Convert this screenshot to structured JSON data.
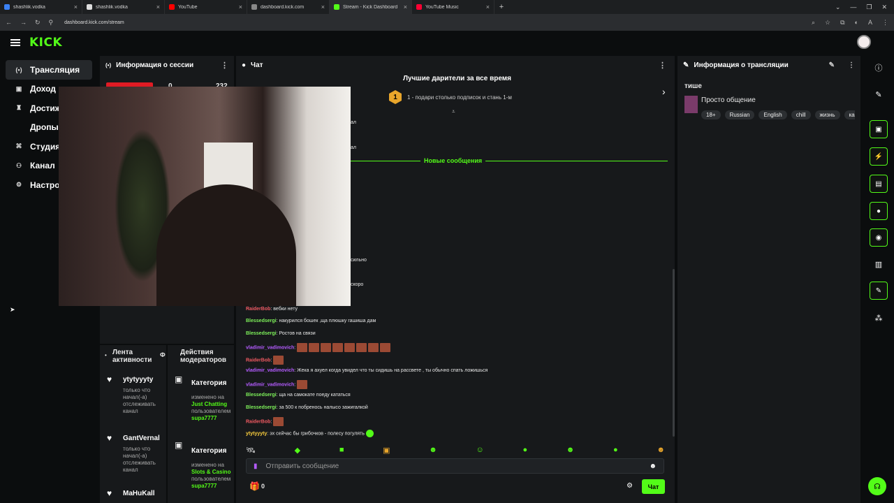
{
  "browser": {
    "tabs": [
      {
        "title": "shashlik.vodka",
        "color": "#3b82f6"
      },
      {
        "title": "shashlik.vodka",
        "color": "#dddddd"
      },
      {
        "title": "YouTube",
        "color": "#ff0000"
      },
      {
        "title": "dashboard.kick.com",
        "color": "#888888"
      },
      {
        "title": "Stream - Kick Dashboard",
        "color": "#53fc18"
      },
      {
        "title": "YouTube Music",
        "color": "#ff0033"
      }
    ],
    "url": "dashboard.kick.com/stream"
  },
  "brand": {
    "logo": "KICK",
    "accent": "#53fc18"
  },
  "sidebar": {
    "items": [
      {
        "label": "Трансляция",
        "icon": "broadcast-icon",
        "glyph": "(•)"
      },
      {
        "label": "Доход",
        "icon": "revenue-icon",
        "glyph": "▣"
      },
      {
        "label": "Достиже",
        "icon": "trophy-icon",
        "glyph": "♜"
      },
      {
        "label": "Дропы и в",
        "icon": "",
        "glyph": ""
      },
      {
        "label": "Студия",
        "icon": "studio-icon",
        "glyph": "⌘"
      },
      {
        "label": "Канал",
        "icon": "channel-icon",
        "glyph": "⚇"
      },
      {
        "label": "Настрой",
        "icon": "settings-icon",
        "glyph": "⚙"
      }
    ]
  },
  "session": {
    "title": "Информация о сессии",
    "stat_a": "0",
    "stat_b": "232"
  },
  "chat": {
    "title": "Чат",
    "gifters_title": "Лучшие дарители за все время",
    "gifters_rank": "1",
    "gifters_text": "1 - подари столько подписок и стань 1-м",
    "new_messages": "Новые сообщения",
    "partial_1": "ал",
    "partial_2": "ал",
    "partial_3": "сильно",
    "partial_4": "скоро",
    "messages": [
      {
        "user": "RaiderBob",
        "text": ": вебки нету",
        "cls": "u-red",
        "emotes": 0
      },
      {
        "user": "Blessedsergi",
        "text": ": накурился бошек ,ща плюшку гашиша дам",
        "cls": "u-grn",
        "emotes": 0
      },
      {
        "user": "Blessedsergi",
        "text": ": Ростов на связи",
        "cls": "u-grn",
        "emotes": 0
      },
      {
        "user": "vladimir_vadimovich",
        "text": ":",
        "cls": "u-pur",
        "emotes": 8
      },
      {
        "user": "RaiderBob",
        "text": ":",
        "cls": "u-red",
        "emotes": 1
      },
      {
        "user": "vladimir_vadimovich",
        "text": ": Жека я ахуел когда увидел что ты сидишь на рассвете , ты обычно спать ложишься",
        "cls": "u-pur",
        "emotes": 0
      },
      {
        "user": "vladimir_vadimovich",
        "text": ":",
        "cls": "u-pur",
        "emotes": 1
      },
      {
        "user": "Blessedsergi",
        "text": ": ща на самокате поеду кататься",
        "cls": "u-grn",
        "emotes": 0
      },
      {
        "user": "Blessedsergi",
        "text": ": за 500 к побренось налысо зажигалкой",
        "cls": "u-grn",
        "emotes": 0
      },
      {
        "user": "RaiderBob",
        "text": ":",
        "cls": "u-red",
        "emotes": 1
      },
      {
        "user": "ytytyyyty",
        "text": ": эх сейчас бы грибочков - полесу погулять",
        "cls": "u-yel",
        "emotes": 0
      }
    ],
    "send_placeholder": "Отправить сообщение",
    "gift_count": "0",
    "send_button": "Чат"
  },
  "stream_info": {
    "title": "Информация о трансляции",
    "channel": "тише",
    "stream_title": "Просто общение",
    "tags": [
      "18+",
      "Russian",
      "English",
      "chill",
      "жизнь",
      "кайф"
    ]
  },
  "activity": {
    "title": "Лента активности",
    "items": [
      {
        "name": "ytytyyyty",
        "sub": "только что начал(-а) отслеживать канал"
      },
      {
        "name": "GantVernal",
        "sub": "только что начал(-а) отслеживать канал"
      },
      {
        "name": "MaHuKall",
        "sub": ""
      }
    ]
  },
  "mod": {
    "title": "Действия модераторов",
    "items": [
      {
        "name": "Категория",
        "pre": "изменено на",
        "value": "Just Chatting",
        "by": "пользователем",
        "user": "supa7777"
      },
      {
        "name": "Категория",
        "pre": "изменено на",
        "value": "Slots & Casino",
        "by": "пользователем",
        "user": "supa7777"
      }
    ]
  }
}
